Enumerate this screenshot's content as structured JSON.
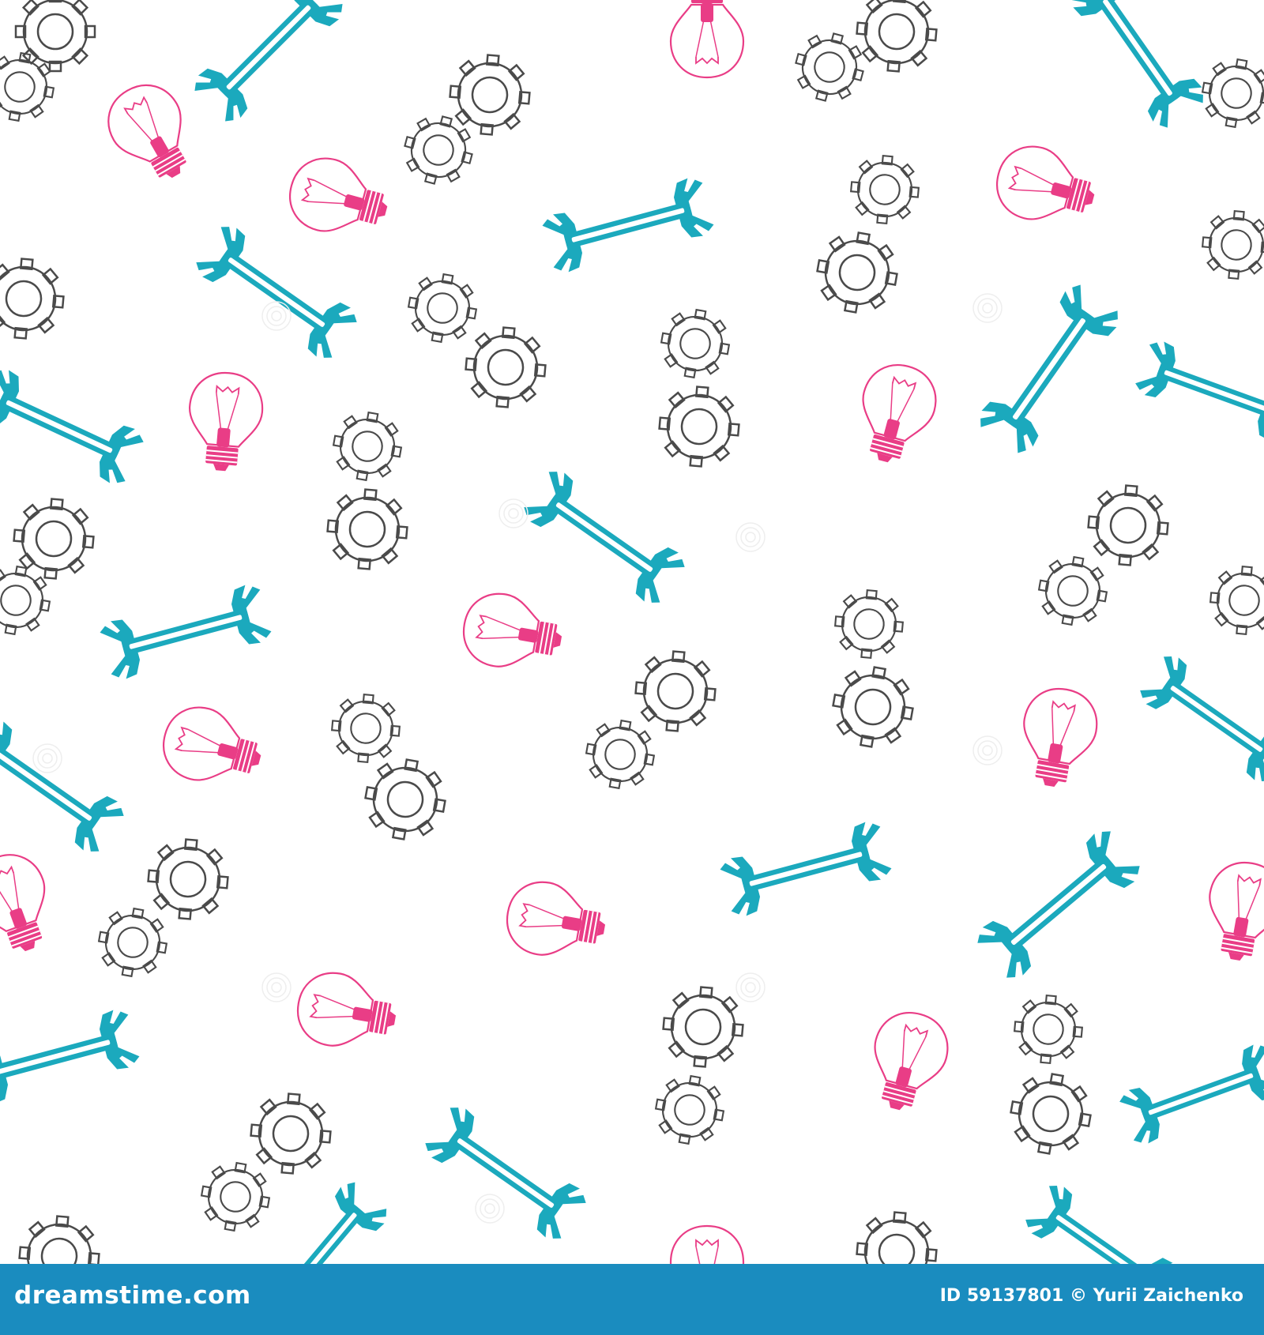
{
  "pattern": {
    "background_color": "#ffffff",
    "gear_color": "#4a4a4a",
    "wrench_color": "#1ba9bd",
    "bulb_color": "#e93d86"
  },
  "footer": {
    "background_color": "#1a8cbf",
    "logo_text": "dreamstime.com",
    "id_text": "ID 59137801",
    "author_text": "© Yurii Zaichenko"
  }
}
